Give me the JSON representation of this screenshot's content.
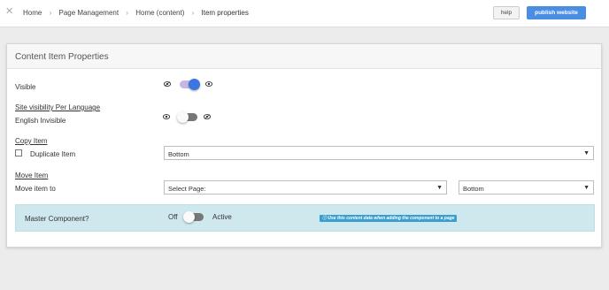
{
  "topbar": {
    "breadcrumbs": [
      "Home",
      "Page Management",
      "Home (content)",
      "Item properties"
    ],
    "help_label": "help",
    "publish_label": "publish website"
  },
  "card": {
    "title": "Content Item Properties",
    "visible": {
      "label": "Visible",
      "toggle_on": true
    },
    "site_visibility": {
      "heading": "Site visibility Per Language",
      "row_label": "English Invisible",
      "toggle_on": false
    },
    "copy_item": {
      "heading": "Copy Item",
      "checkbox_label": "Duplicate Item",
      "checked": false,
      "position_value": "Bottom"
    },
    "move_item": {
      "heading": "Move Item",
      "row_label": "Move item to",
      "page_select_value": "Select Page:",
      "position_value": "Bottom"
    },
    "master_component": {
      "label": "Master Component?",
      "off_label": "Off",
      "active_label": "Active",
      "toggle_on": false,
      "info_text": "Use this content data when adding the component to a page"
    }
  },
  "colors": {
    "accent_blue": "#4a8ee4",
    "toggle_knob_on": "#3b77e0",
    "info_panel_bg": "#cfe8ee",
    "info_badge": "#3a9fd0"
  }
}
